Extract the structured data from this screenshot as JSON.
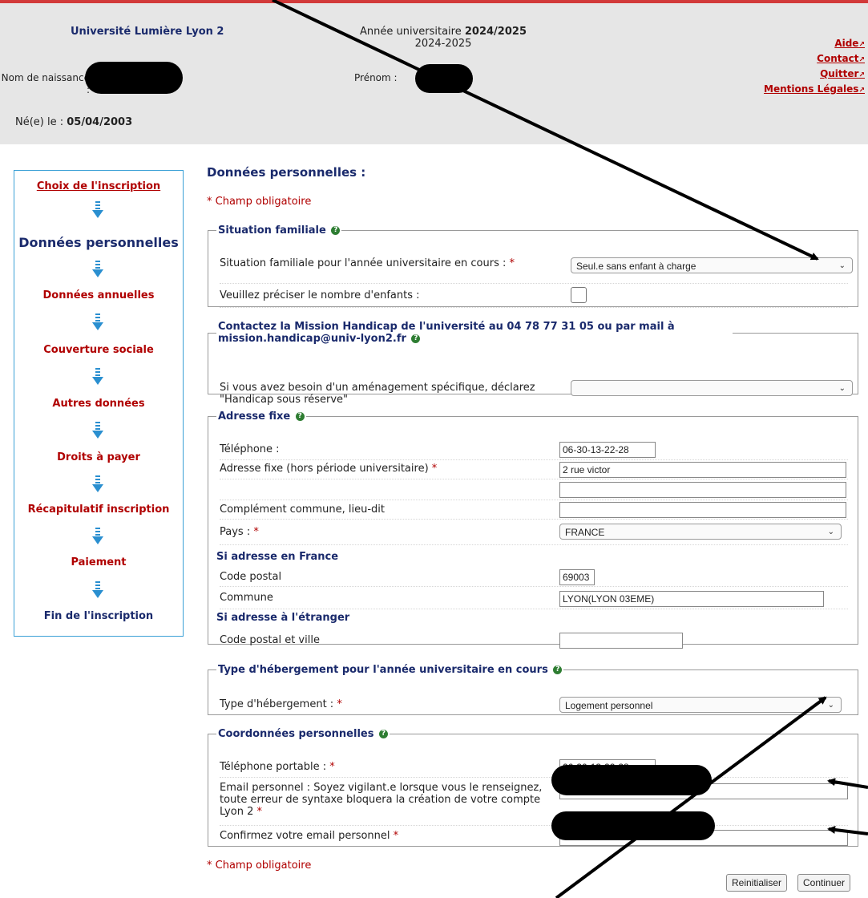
{
  "header": {
    "university": "Université Lumière Lyon 2",
    "year_label": "Année universitaire ",
    "year_bold": "2024/2025",
    "year_sub": "2024-2025",
    "nom_label": "Nom de naissance :",
    "prenom_label": "Prénom :",
    "ne_label": "Né(e) le : ",
    "ne_value": "05/04/2003",
    "links": [
      "Aide",
      "Contact",
      "Quitter",
      "Mentions Légales"
    ]
  },
  "sidebar": {
    "steps": [
      "Choix de l'inscription",
      "Données personnelles",
      "Données annuelles",
      "Couverture sociale",
      "Autres données",
      "Droits à payer",
      "Récapitulatif inscription",
      "Paiement",
      "Fin de l'inscription"
    ],
    "current": "Données personnelles"
  },
  "page": {
    "title": "Données personnelles :",
    "required_note": "* Champ obligatoire"
  },
  "situation": {
    "legend": "Situation familiale",
    "label": "Situation familiale pour l'année universitaire en cours :",
    "value": "Seul.e sans enfant à charge",
    "children_label": "Veuillez préciser le nombre d'enfants :"
  },
  "handicap": {
    "legend": "Contactez la Mission Handicap de l'université au 04 78 77 31 05 ou par mail à mission.handicap@univ-lyon2.fr",
    "label": "Si vous avez besoin d'un aménagement spécifique, déclarez \"Handicap sous réserve\"",
    "value": ""
  },
  "adresse": {
    "legend": "Adresse fixe",
    "telephone_label": "Téléphone :",
    "telephone_value": "06-30-13-22-28",
    "adresse_label": "Adresse fixe (hors période universitaire)",
    "adresse_value": "2 rue victor",
    "adresse2_value": "",
    "complement_label": "Complément commune, lieu-dit",
    "complement_value": "",
    "pays_label": "Pays :",
    "pays_value": "FRANCE",
    "france_heading": "Si adresse en France",
    "cp_label": "Code postal",
    "cp_value": "69003",
    "commune_label": "Commune",
    "commune_value": "LYON(LYON 03EME)",
    "etranger_heading": "Si adresse à l'étranger",
    "cpville_label": "Code postal et ville",
    "cpville_value": ""
  },
  "hebergement": {
    "legend": "Type d'hébergement pour l'année universitaire en cours",
    "label": "Type d'hébergement :",
    "value": "Logement personnel"
  },
  "coordonnees": {
    "legend": "Coordonnées personnelles",
    "portable_label": "Téléphone portable :",
    "portable_value": "06-30-13-22-28",
    "email_label": "Email personnel : Soyez vigilant.e lorsque vous le renseignez, toute erreur de syntaxe bloquera la création de votre compte Lyon 2",
    "confirm_label": "Confirmez votre email personnel"
  },
  "buttons": {
    "reset": "Reinitialiser",
    "continue": "Continuer"
  },
  "colors": {
    "accent_red": "#b00000",
    "navy": "#1a2a6c",
    "sidebar_border": "#3aa0d6",
    "header_bg": "#e6e6e6"
  }
}
